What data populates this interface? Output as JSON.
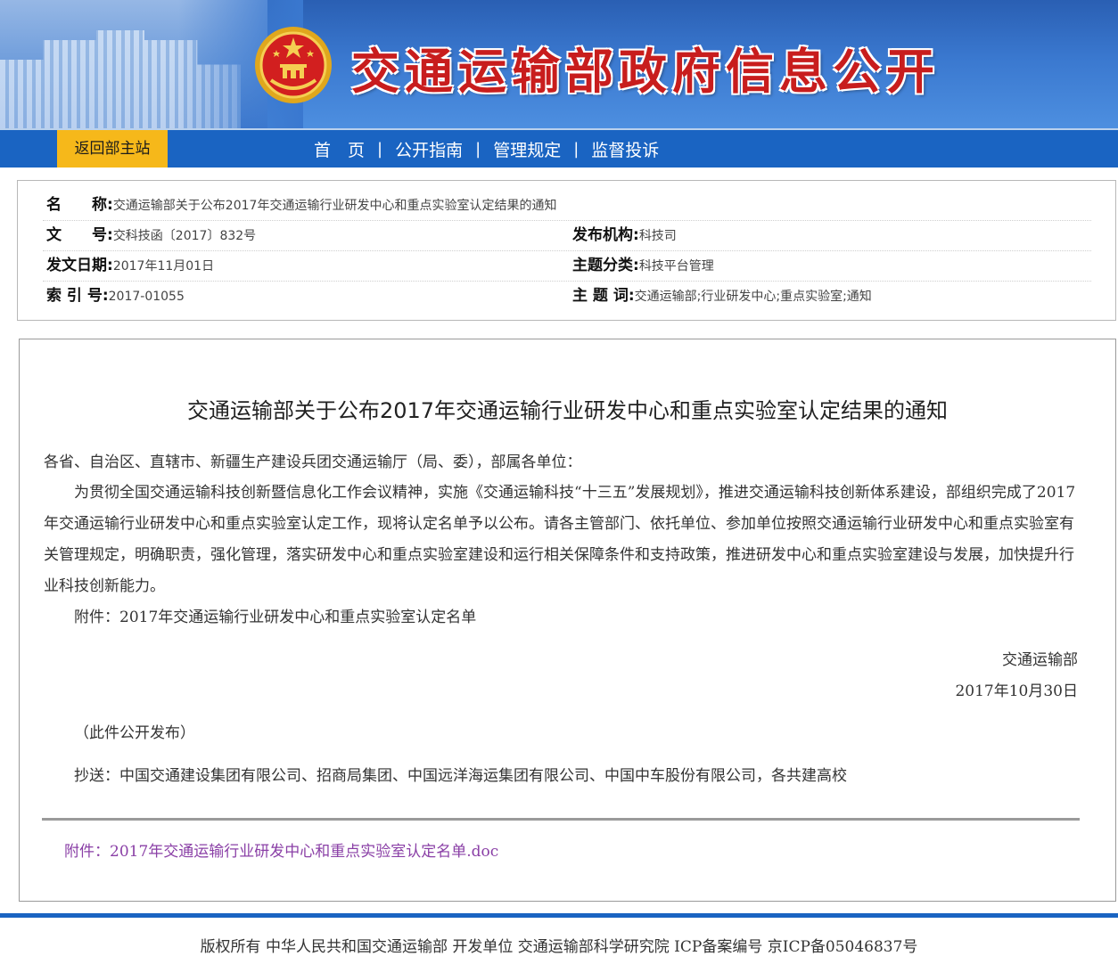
{
  "header": {
    "site_title": "交通运输部政府信息公开",
    "emblem_icon": "national-emblem-icon",
    "colors": {
      "banner": "#3a78cf",
      "title": "#c81d1d"
    }
  },
  "nav": {
    "home_button": "返回部主站",
    "items": [
      "首　页",
      "公开指南",
      "管理规定",
      "监督投诉"
    ],
    "colors": {
      "bar": "#1a64c2",
      "home_button": "#f6b81a"
    }
  },
  "meta": {
    "name_label": "名　　称:",
    "name_value": "交通运输部关于公布2017年交通运输行业研发中心和重点实验室认定结果的通知",
    "docno_label": "文　　号:",
    "docno_value": "交科技函〔2017〕832号",
    "publisher_label": "发布机构:",
    "publisher_value": "科技司",
    "date_label": "发文日期:",
    "date_value": "2017年11月01日",
    "category_label": "主题分类:",
    "category_value": "科技平台管理",
    "index_label": "索 引 号:",
    "index_value": "2017-01055",
    "keywords_label": "主 题 词:",
    "keywords_value": "交通运输部;行业研发中心;重点实验室;通知"
  },
  "doc": {
    "title": "交通运输部关于公布2017年交通运输行业研发中心和重点实验室认定结果的通知",
    "salutation": "各省、自治区、直辖市、新疆生产建设兵团交通运输厅（局、委），部属各单位：",
    "body": "为贯彻全国交通运输科技创新暨信息化工作会议精神，实施《交通运输科技“十三五”发展规划》，推进交通运输科技创新体系建设，部组织完成了2017年交通运输行业研发中心和重点实验室认定工作，现将认定名单予以公布。请各主管部门、依托单位、参加单位按照交通运输行业研发中心和重点实验室有关管理规定，明确职责，强化管理，落实研发中心和重点实验室建设和运行相关保障条件和支持政策，推进研发中心和重点实验室建设与发展，加快提升行业科技创新能力。",
    "attachment_note": "附件：2017年交通运输行业研发中心和重点实验室认定名单",
    "signature": "交通运输部",
    "sign_date": "2017年10月30日",
    "public_note": "（此件公开发布）",
    "cc": "抄送：中国交通建设集团有限公司、招商局集团、中国远洋海运集团有限公司、中国中车股份有限公司，各共建高校",
    "attachment_link": "附件：2017年交通运输行业研发中心和重点实验室认定名单.doc",
    "link_color": "#8a3fa6"
  },
  "footer": {
    "text": "版权所有 中华人民共和国交通运输部 开发单位 交通运输部科学研究院 ICP备案编号 京ICP备05046837号"
  }
}
